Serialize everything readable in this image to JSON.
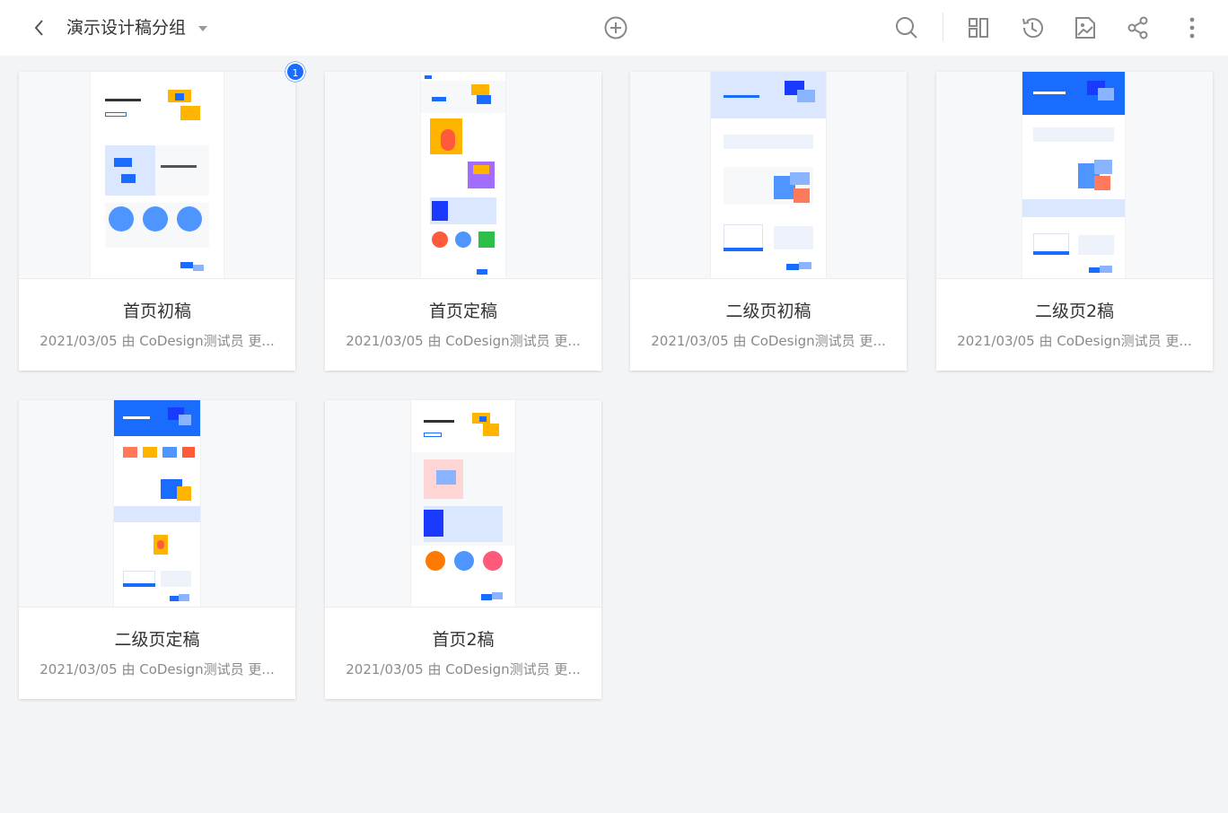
{
  "header": {
    "title": "演示设计稿分组",
    "icons": {
      "back": "chevron-left-icon",
      "dropdown": "caret-down-icon",
      "add": "plus-circle-icon",
      "search": "search-icon",
      "layout": "layout-icon",
      "history": "history-icon",
      "export": "image-export-icon",
      "share": "share-icon",
      "more": "more-vertical-icon"
    }
  },
  "colors": {
    "accent": "#1a6cff",
    "background": "#f3f4f6"
  },
  "cards": [
    {
      "name": "首页初稿",
      "meta": "2021/03/05 由 CoDesign测试员 更...",
      "badge": "1"
    },
    {
      "name": "首页定稿",
      "meta": "2021/03/05 由 CoDesign测试员 更..."
    },
    {
      "name": "二级页初稿",
      "meta": "2021/03/05 由 CoDesign测试员 更..."
    },
    {
      "name": "二级页2稿",
      "meta": "2021/03/05 由 CoDesign测试员 更..."
    },
    {
      "name": "二级页定稿",
      "meta": "2021/03/05 由 CoDesign测试员 更..."
    },
    {
      "name": "首页2稿",
      "meta": "2021/03/05 由 CoDesign测试员 更..."
    }
  ]
}
